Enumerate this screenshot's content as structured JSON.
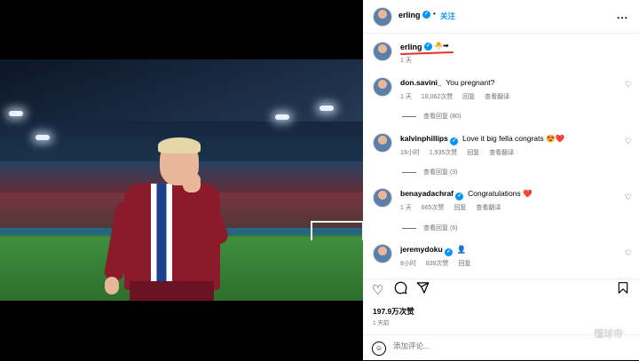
{
  "header": {
    "username": "erling",
    "follow_label": "关注",
    "separator": "•",
    "more": "..."
  },
  "caption": {
    "username": "erling",
    "emoji": "🐣➡",
    "time": "1 天"
  },
  "comments": [
    {
      "username": "don.savini_",
      "verified": false,
      "text": "You pregnant?",
      "time": "1 天",
      "likes": "18,062次赞",
      "reply_label": "回复",
      "translate_label": "查看翻译",
      "view_replies": "查看回复 (80)"
    },
    {
      "username": "kalvinphillips",
      "verified": true,
      "text": "Love it big fella congrats 😍❤️",
      "time": "19小时",
      "likes": "1,935次赞",
      "reply_label": "回复",
      "translate_label": "查看翻译",
      "view_replies": "查看回复 (3)"
    },
    {
      "username": "benayadachraf",
      "verified": true,
      "text": "Congratulations ❤️",
      "time": "1 天",
      "likes": "665次赞",
      "reply_label": "回复",
      "translate_label": "查看翻译",
      "view_replies": "查看回复 (6)"
    },
    {
      "username": "jeremydoku",
      "verified": true,
      "text": "👤",
      "time": "8小时",
      "likes": "839次赞",
      "reply_label": "回复"
    }
  ],
  "actions": {
    "likes_count": "197.9万次赞",
    "time": "1 天前"
  },
  "add_comment": {
    "placeholder": "添加评论..."
  },
  "watermark": "懂球帝",
  "icons": {
    "like": "heart-icon",
    "comment": "comment-icon",
    "share": "send-icon",
    "save": "bookmark-icon",
    "emoji": "emoji-icon"
  },
  "colors": {
    "verified": "#0095f6",
    "follow": "#0095f6",
    "meta": "#737373",
    "jersey_red": "#8b1a2a",
    "jersey_blue": "#1d3f8f"
  }
}
